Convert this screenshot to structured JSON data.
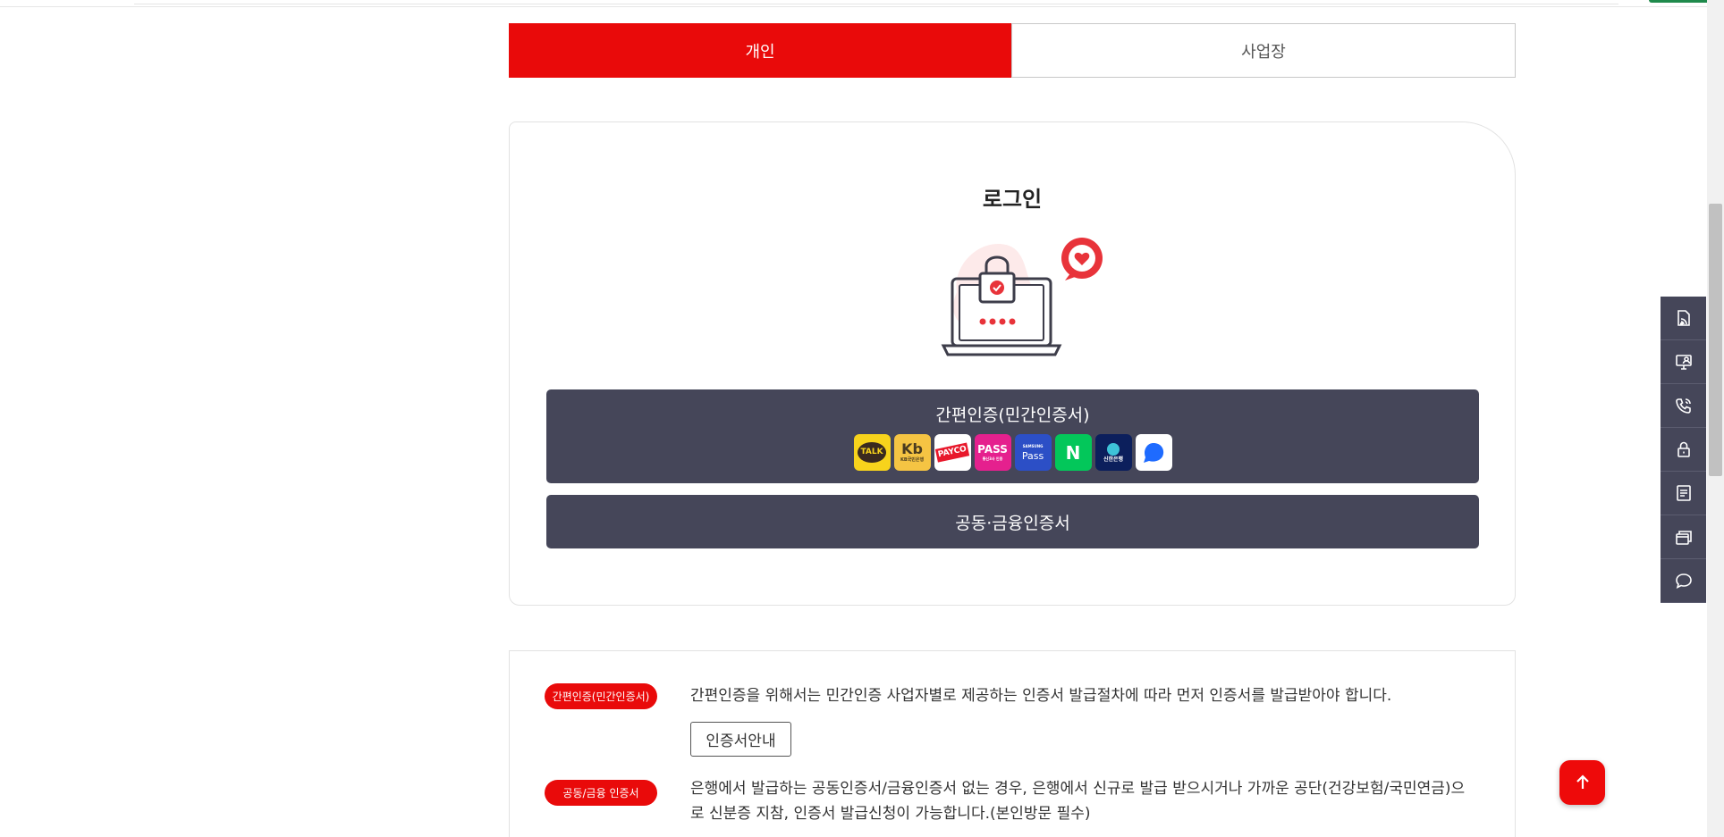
{
  "tabs": [
    {
      "label": "개인",
      "active": true
    },
    {
      "label": "사업장",
      "active": false
    }
  ],
  "login": {
    "title": "로그인",
    "simple_auth_label": "간편인증(민간인증서)",
    "providers": [
      {
        "name": "kakao",
        "label": "TALK"
      },
      {
        "name": "kb",
        "label": "Kb",
        "sub": "KB국민은행"
      },
      {
        "name": "payco",
        "label": "PAYCO"
      },
      {
        "name": "pass",
        "label": "PASS",
        "sub": "통신3사 인증"
      },
      {
        "name": "samsung-pass",
        "label": "Pass",
        "sub": "SAMSUNG"
      },
      {
        "name": "naver",
        "label": "N"
      },
      {
        "name": "shinhan",
        "label": "신한은행"
      },
      {
        "name": "toss",
        "label": ""
      }
    ],
    "cert_label": "공동·금융인증서"
  },
  "info": {
    "badge1": "간편인증(민간인증서)",
    "text1": "간편인증을 위해서는 민간인증 사업자별로 제공하는 인증서 발급절차에 따라 먼저 인증서를 발급받아야 합니다.",
    "guide_button": "인증서안내",
    "badge2": "공동/금융 인증서",
    "text2": "은행에서 발급하는 공동인증서/금융인증서 없는 경우, 은행에서 신규로 발급 받으시거나 가까운 공단(건강보험/국민연금)으로 신분증 지참, 인증서 발급신청이 가능합니다.(본인방문 필수)"
  },
  "colors": {
    "accent_red": "#e90a0a",
    "dark_button": "#454659"
  },
  "quick_menu": [
    "document-wifi-icon",
    "monitor-person-icon",
    "phone-icon",
    "lock-icon",
    "list-document-icon",
    "cards-icon",
    "chat-bubble-icon"
  ]
}
